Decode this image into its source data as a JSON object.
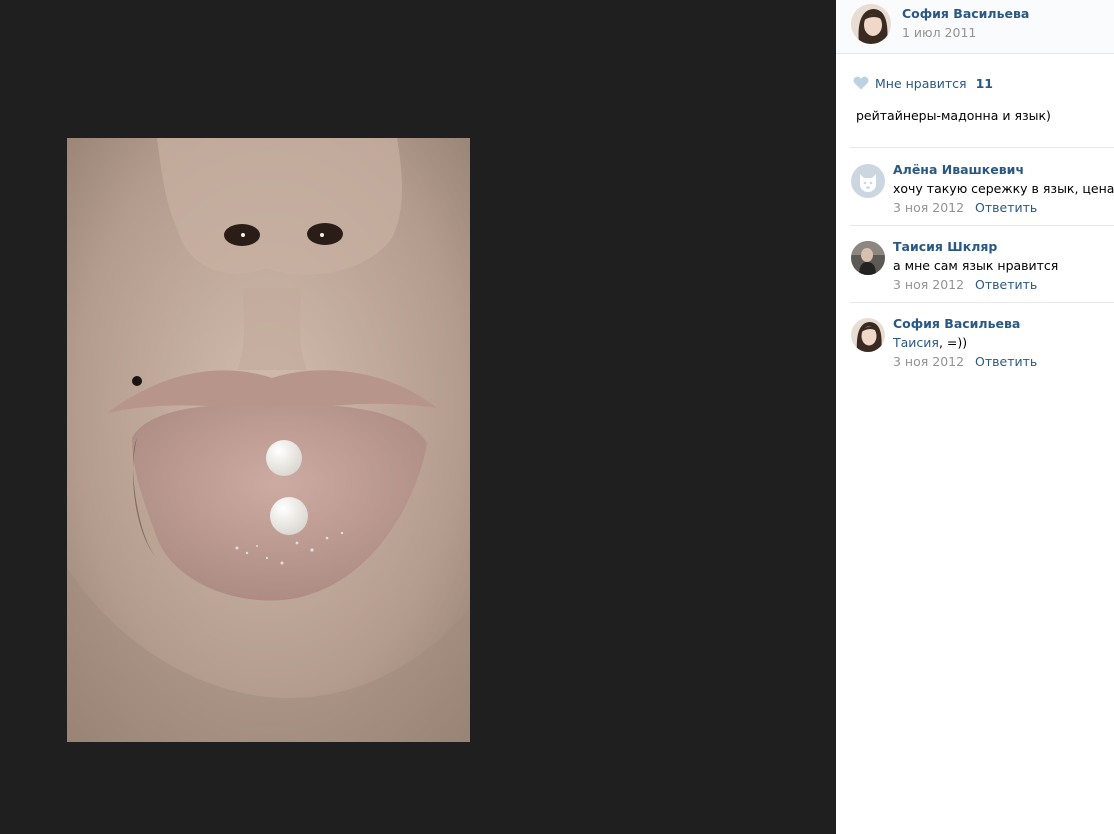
{
  "photo": {
    "alt": "photo"
  },
  "author": {
    "name": "София Васильева",
    "date": "1 июл 2011"
  },
  "likes": {
    "label": "Мне нравится",
    "count": "11",
    "icon": "heart-icon"
  },
  "caption": "рейтайнеры-мадонна и язык)",
  "comments": [
    {
      "author": "Алёна Ивашкевич",
      "text": "хочу такую сережку в язык, цена?",
      "date": "3 ноя 2012",
      "reply_label": "Ответить",
      "avatar": "deactivated-dog-avatar"
    },
    {
      "author": "Таисия Шкляр",
      "text": "а мне сам язык нравится",
      "date": "3 ноя 2012",
      "reply_label": "Ответить",
      "avatar": "user-photo-avatar"
    },
    {
      "author": "София Васильева",
      "mention": "Таисия",
      "text": ", =))",
      "date": "3 ноя 2012",
      "reply_label": "Ответить",
      "avatar": "user-photo-avatar"
    }
  ],
  "colors": {
    "link": "#2a5885",
    "muted": "#939393",
    "viewer_bg": "#1f1f1f",
    "divider": "#e7e8ec"
  }
}
